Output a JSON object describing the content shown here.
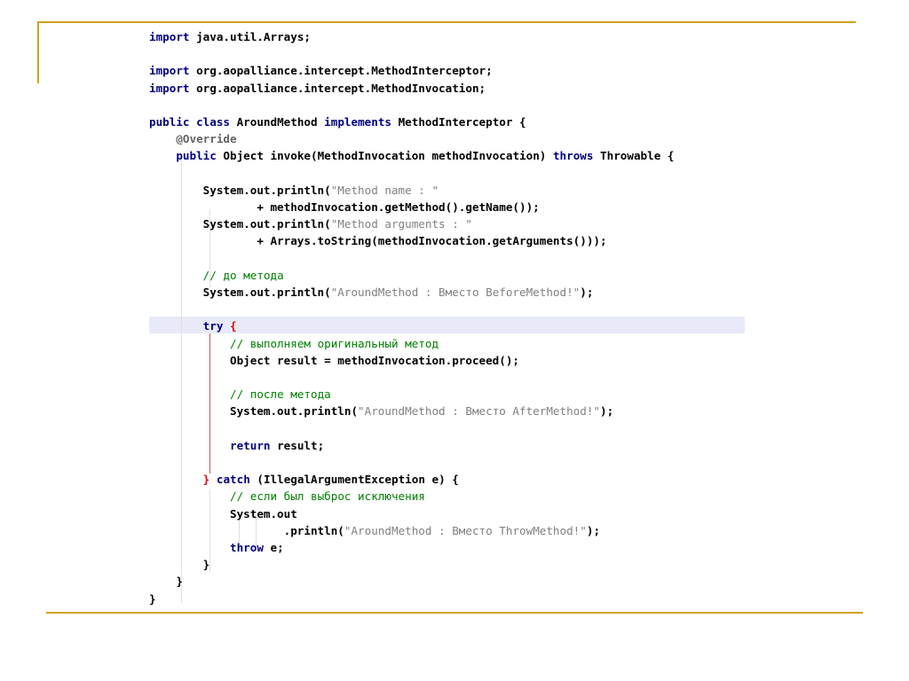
{
  "colors": {
    "frame_accent": "#d4a017",
    "keyword": "#000080",
    "string": "#808080",
    "comment": "#008000",
    "highlight_line": "#e8eaf9"
  },
  "code": {
    "language": "java",
    "lines": [
      [
        {
          "t": "kw",
          "v": "import"
        },
        {
          "t": "id",
          "v": " java.util.Arrays;"
        }
      ],
      [],
      [
        {
          "t": "kw",
          "v": "import"
        },
        {
          "t": "id",
          "v": " org.aopalliance.intercept.MethodInterceptor;"
        }
      ],
      [
        {
          "t": "kw",
          "v": "import"
        },
        {
          "t": "id",
          "v": " org.aopalliance.intercept.MethodInvocation;"
        }
      ],
      [],
      [
        {
          "t": "kw",
          "v": "public class"
        },
        {
          "t": "id",
          "v": " AroundMethod "
        },
        {
          "t": "kw",
          "v": "implements"
        },
        {
          "t": "id",
          "v": " MethodInterceptor {"
        }
      ],
      [
        {
          "t": "id",
          "v": "    "
        },
        {
          "t": "ann",
          "v": "@Override"
        }
      ],
      [
        {
          "t": "id",
          "v": "    "
        },
        {
          "t": "kw",
          "v": "public"
        },
        {
          "t": "id",
          "v": " Object invoke(MethodInvocation methodInvocation) "
        },
        {
          "t": "kw",
          "v": "throws"
        },
        {
          "t": "id",
          "v": " Throwable {"
        }
      ],
      [],
      [
        {
          "t": "id",
          "v": "        System.out.println("
        },
        {
          "t": "str",
          "v": "\"Method name : \""
        }
      ],
      [
        {
          "t": "id",
          "v": "                + methodInvocation.getMethod().getName());"
        }
      ],
      [
        {
          "t": "id",
          "v": "        System.out.println("
        },
        {
          "t": "str",
          "v": "\"Method arguments : \""
        }
      ],
      [
        {
          "t": "id",
          "v": "                + Arrays.toString(methodInvocation.getArguments()));"
        }
      ],
      [],
      [
        {
          "t": "id",
          "v": "        "
        },
        {
          "t": "cm",
          "v": "// до метода"
        }
      ],
      [
        {
          "t": "id",
          "v": "        System.out.println("
        },
        {
          "t": "str",
          "v": "\"AroundMethod : Вместо BeforeMethod!\""
        },
        {
          "t": "id",
          "v": ");"
        }
      ],
      [],
      [
        {
          "t": "id",
          "v": "        "
        },
        {
          "t": "kw",
          "v": "try"
        },
        {
          "t": "id",
          "v": " "
        },
        {
          "t": "brace-red",
          "v": "{"
        }
      ],
      [
        {
          "t": "id",
          "v": "            "
        },
        {
          "t": "cm",
          "v": "// выполняем оригинальный метод"
        }
      ],
      [
        {
          "t": "id",
          "v": "            Object result = methodInvocation.proceed();"
        }
      ],
      [],
      [
        {
          "t": "id",
          "v": "            "
        },
        {
          "t": "cm",
          "v": "// после метода"
        }
      ],
      [
        {
          "t": "id",
          "v": "            System.out.println("
        },
        {
          "t": "str",
          "v": "\"AroundMethod : Вместо AfterMethod!\""
        },
        {
          "t": "id",
          "v": ");"
        }
      ],
      [],
      [
        {
          "t": "id",
          "v": "            "
        },
        {
          "t": "kw",
          "v": "return"
        },
        {
          "t": "id",
          "v": " result;"
        }
      ],
      [],
      [
        {
          "t": "id",
          "v": "        "
        },
        {
          "t": "brace-red",
          "v": "}"
        },
        {
          "t": "id",
          "v": " "
        },
        {
          "t": "kw",
          "v": "catch"
        },
        {
          "t": "id",
          "v": " (IllegalArgumentException e) {"
        }
      ],
      [
        {
          "t": "id",
          "v": "            "
        },
        {
          "t": "cm",
          "v": "// если был выброс исключения"
        }
      ],
      [
        {
          "t": "id",
          "v": "            System.out"
        }
      ],
      [
        {
          "t": "id",
          "v": "                    .println("
        },
        {
          "t": "str",
          "v": "\"AroundMethod : Вместо ThrowMethod!\""
        },
        {
          "t": "id",
          "v": ");"
        }
      ],
      [
        {
          "t": "id",
          "v": "            "
        },
        {
          "t": "kw",
          "v": "throw"
        },
        {
          "t": "id",
          "v": " e;"
        }
      ],
      [
        {
          "t": "id",
          "v": "        }"
        }
      ],
      [
        {
          "t": "id",
          "v": "    }"
        }
      ],
      [
        {
          "t": "id",
          "v": "}"
        }
      ]
    ]
  }
}
